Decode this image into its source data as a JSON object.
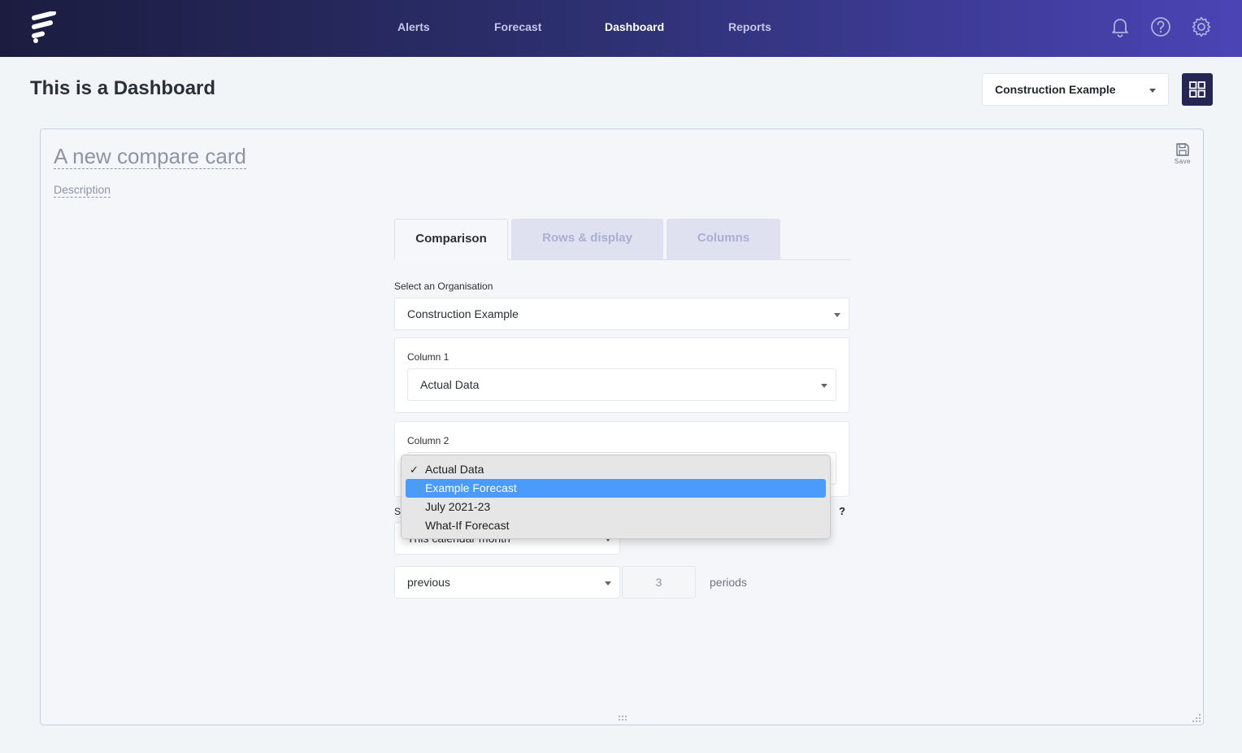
{
  "nav": {
    "items": [
      {
        "label": "Alerts",
        "active": false
      },
      {
        "label": "Forecast",
        "active": false
      },
      {
        "label": "Dashboard",
        "active": true
      },
      {
        "label": "Reports",
        "active": false
      }
    ],
    "icons": [
      "bell-icon",
      "help-circle-icon",
      "gear-icon"
    ]
  },
  "header": {
    "title": "This is a Dashboard",
    "org_select_value": "Construction Example",
    "layout_button_icon": "grid-icon"
  },
  "card": {
    "title": "A new compare card",
    "description": "Description",
    "save_label": "Save",
    "tabs": [
      {
        "label": "Comparison",
        "active": true
      },
      {
        "label": "Rows & display",
        "active": false
      },
      {
        "label": "Columns",
        "active": false
      }
    ],
    "organisation": {
      "label": "Select an Organisation",
      "value": "Construction Example"
    },
    "column1": {
      "label": "Column 1",
      "value": "Actual Data"
    },
    "column2": {
      "label": "Column 2"
    },
    "period": {
      "partial_label": "S",
      "value": "This calendar month",
      "help": "?"
    },
    "range": {
      "direction": "previous",
      "count": "3",
      "unit": "periods"
    }
  },
  "dropdown": {
    "options": [
      {
        "label": "Actual Data",
        "checked": true,
        "highlighted": false
      },
      {
        "label": "Example Forecast",
        "checked": false,
        "highlighted": true
      },
      {
        "label": "July 2021-23",
        "checked": false,
        "highlighted": false
      },
      {
        "label": "What-If Forecast",
        "checked": false,
        "highlighted": false
      }
    ]
  },
  "colors": {
    "nav_gradient_start": "#1b1c3f",
    "nav_gradient_end": "#4a44b5",
    "highlight": "#4a9bfc",
    "grid_button": "#252655"
  }
}
